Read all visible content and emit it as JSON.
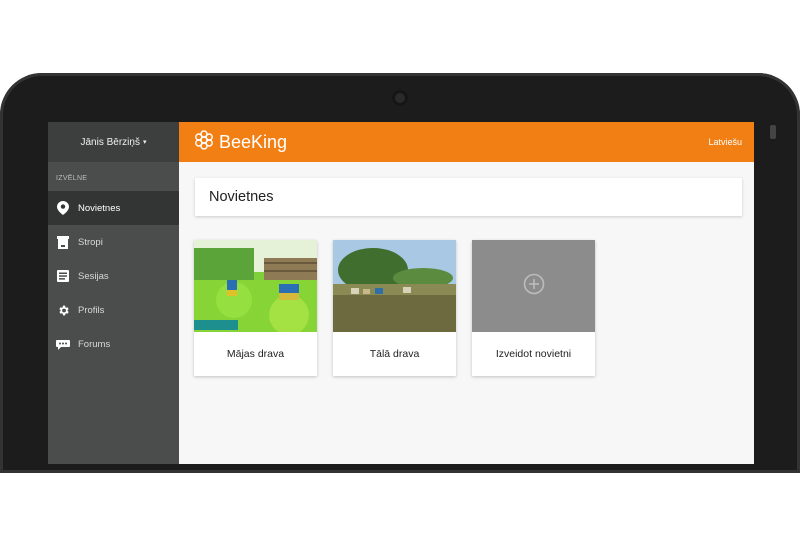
{
  "sidebar": {
    "user_name": "Jānis Bērziņš",
    "user_caret": "▾",
    "menu_heading": "IZVĒLNE",
    "items": [
      {
        "label": "Novietnes",
        "icon": "map-pin-icon",
        "active": true
      },
      {
        "label": "Stropi",
        "icon": "hive-box-icon",
        "active": false
      },
      {
        "label": "Sesijas",
        "icon": "list-icon",
        "active": false
      },
      {
        "label": "Profils",
        "icon": "gear-icon",
        "active": false
      },
      {
        "label": "Forums",
        "icon": "chat-icon",
        "active": false
      }
    ]
  },
  "topbar": {
    "brand": "BeeKing",
    "brand_icon": "honeycomb-flower-icon",
    "language": "Latviešu"
  },
  "main": {
    "title": "Novietnes",
    "cards": [
      {
        "label": "Mājas drava",
        "image": "garden-apiary-photo"
      },
      {
        "label": "Tālā drava",
        "image": "field-apiary-photo"
      },
      {
        "label": "Izveidot novietni",
        "icon": "add-circle-icon"
      }
    ]
  },
  "colors": {
    "accent": "#f27f14",
    "sidebar": "#4a4d4b",
    "sidebar_active": "#333534",
    "background": "#f7f7f7",
    "placeholder": "#8c8c8c"
  }
}
